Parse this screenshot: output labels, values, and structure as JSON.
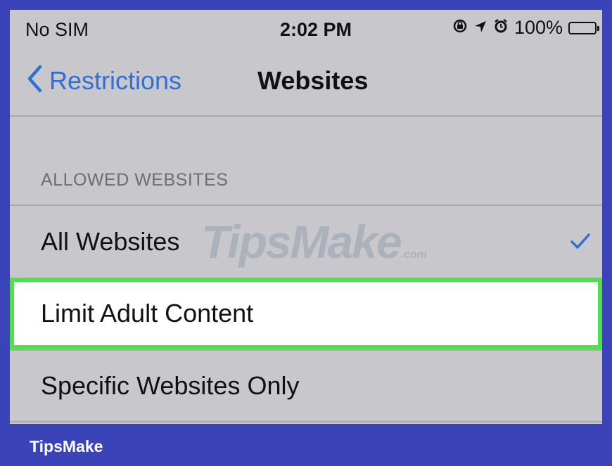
{
  "status_bar": {
    "carrier": "No SIM",
    "time": "2:02 PM",
    "battery": "100%",
    "battery_level": 1.0,
    "icons": [
      "rotation-lock-icon",
      "location-arrow-icon",
      "alarm-icon",
      "battery-icon"
    ]
  },
  "nav": {
    "back_label": "Restrictions",
    "title": "Websites"
  },
  "section": {
    "header": "ALLOWED WEBSITES"
  },
  "rows": [
    {
      "label": "All Websites",
      "checked": true
    },
    {
      "label": "Limit Adult Content",
      "checked": false,
      "highlighted": true
    },
    {
      "label": "Specific Websites Only",
      "checked": false
    }
  ],
  "watermark": {
    "main": "TipsMake",
    "suffix": ".com"
  },
  "footer": {
    "brand": "TipsMake"
  },
  "colors": {
    "accent_blue": "#2f6fd6",
    "highlight_green": "#4fe04a",
    "frame_blue": "#3a44b8",
    "background_gray": "#c8c8cc"
  }
}
